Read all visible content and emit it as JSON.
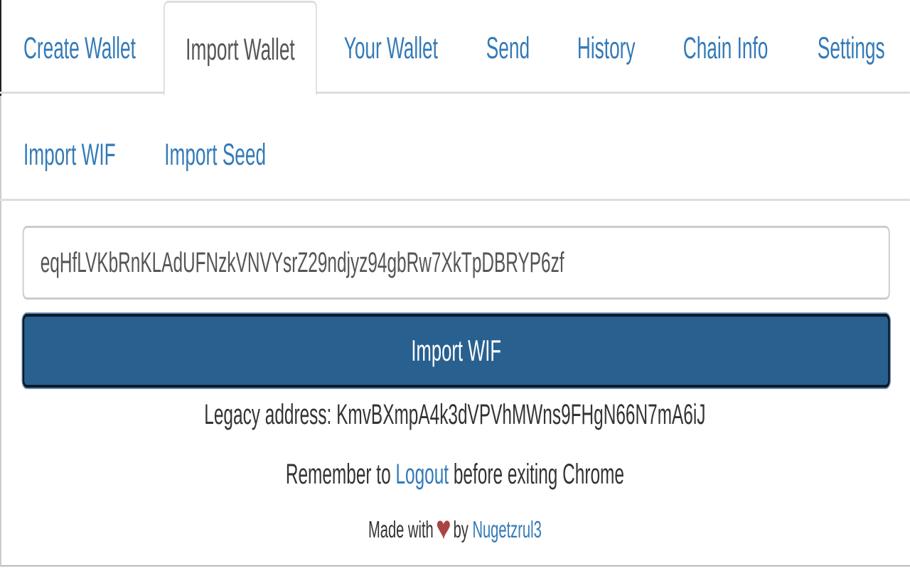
{
  "tabs": [
    {
      "label": "Create Wallet",
      "active": false
    },
    {
      "label": "Import Wallet",
      "active": true
    },
    {
      "label": "Your Wallet",
      "active": false
    },
    {
      "label": "Send",
      "active": false
    },
    {
      "label": "History",
      "active": false
    },
    {
      "label": "Chain Info",
      "active": false
    },
    {
      "label": "Settings",
      "active": false
    }
  ],
  "subtabs": [
    {
      "label": "Import WIF",
      "active": true
    },
    {
      "label": "Import Seed",
      "active": false
    }
  ],
  "wif_input": {
    "value": "eqHfLVKbRnKLAdUFNzkVNVYsrZ29ndjyz94gbRw7XkTpDBRYP6zf"
  },
  "import_button": {
    "label": "Import WIF"
  },
  "legacy_address": {
    "label": "Legacy address:",
    "value": "KmvBXmpA4k3dVPVhMWns9FHgN66N7mA6iJ"
  },
  "footer": {
    "remember_before": "Remember to",
    "logout_link": "Logout",
    "remember_after": "before exiting Chrome",
    "made_with": "Made with",
    "heart": "♥",
    "by": "by",
    "author_link": "Nugetzrul3"
  },
  "colors": {
    "link": "#337ab7",
    "button": "#286090",
    "heart": "#a94442"
  }
}
